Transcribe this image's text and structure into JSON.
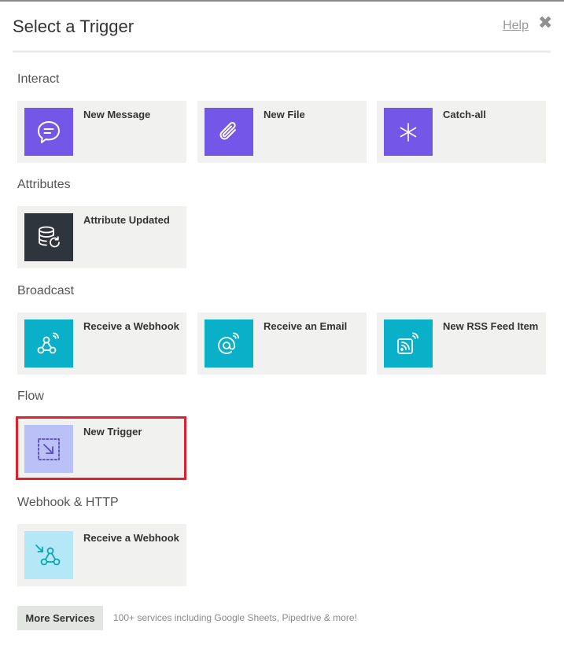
{
  "dialog": {
    "title": "Select a Trigger",
    "help_label": "Help",
    "close_glyph": "✖"
  },
  "sections": [
    {
      "title": "Interact",
      "items": [
        {
          "label": "New Message",
          "icon": "chat-bubble-icon",
          "color": "#7357e6"
        },
        {
          "label": "New File",
          "icon": "paperclip-icon",
          "color": "#7357e6"
        },
        {
          "label": "Catch-all",
          "icon": "asterisk-icon",
          "color": "#7357e6"
        }
      ]
    },
    {
      "title": "Attributes",
      "items": [
        {
          "label": "Attribute Updated",
          "icon": "database-refresh-icon",
          "color": "#2f353c"
        }
      ]
    },
    {
      "title": "Broadcast",
      "items": [
        {
          "label": "Receive a Webhook",
          "icon": "webhook-icon",
          "color": "#0ab0c8"
        },
        {
          "label": "Receive an Email",
          "icon": "at-sign-icon",
          "color": "#0ab0c8"
        },
        {
          "label": "New RSS Feed Item",
          "icon": "rss-feed-icon",
          "color": "#0ab0c8"
        }
      ]
    },
    {
      "title": "Flow",
      "items": [
        {
          "label": "New Trigger",
          "icon": "trigger-arrow-icon",
          "color": "#b9c1f7"
        }
      ]
    },
    {
      "title": "Webhook & HTTP",
      "items": [
        {
          "label": "Receive a Webhook",
          "icon": "webhook-icon",
          "color": "#b4e8f6"
        }
      ]
    }
  ],
  "footer": {
    "more_button": "More Services",
    "description": "100+ services including Google Sheets, Pipedrive & more!"
  }
}
